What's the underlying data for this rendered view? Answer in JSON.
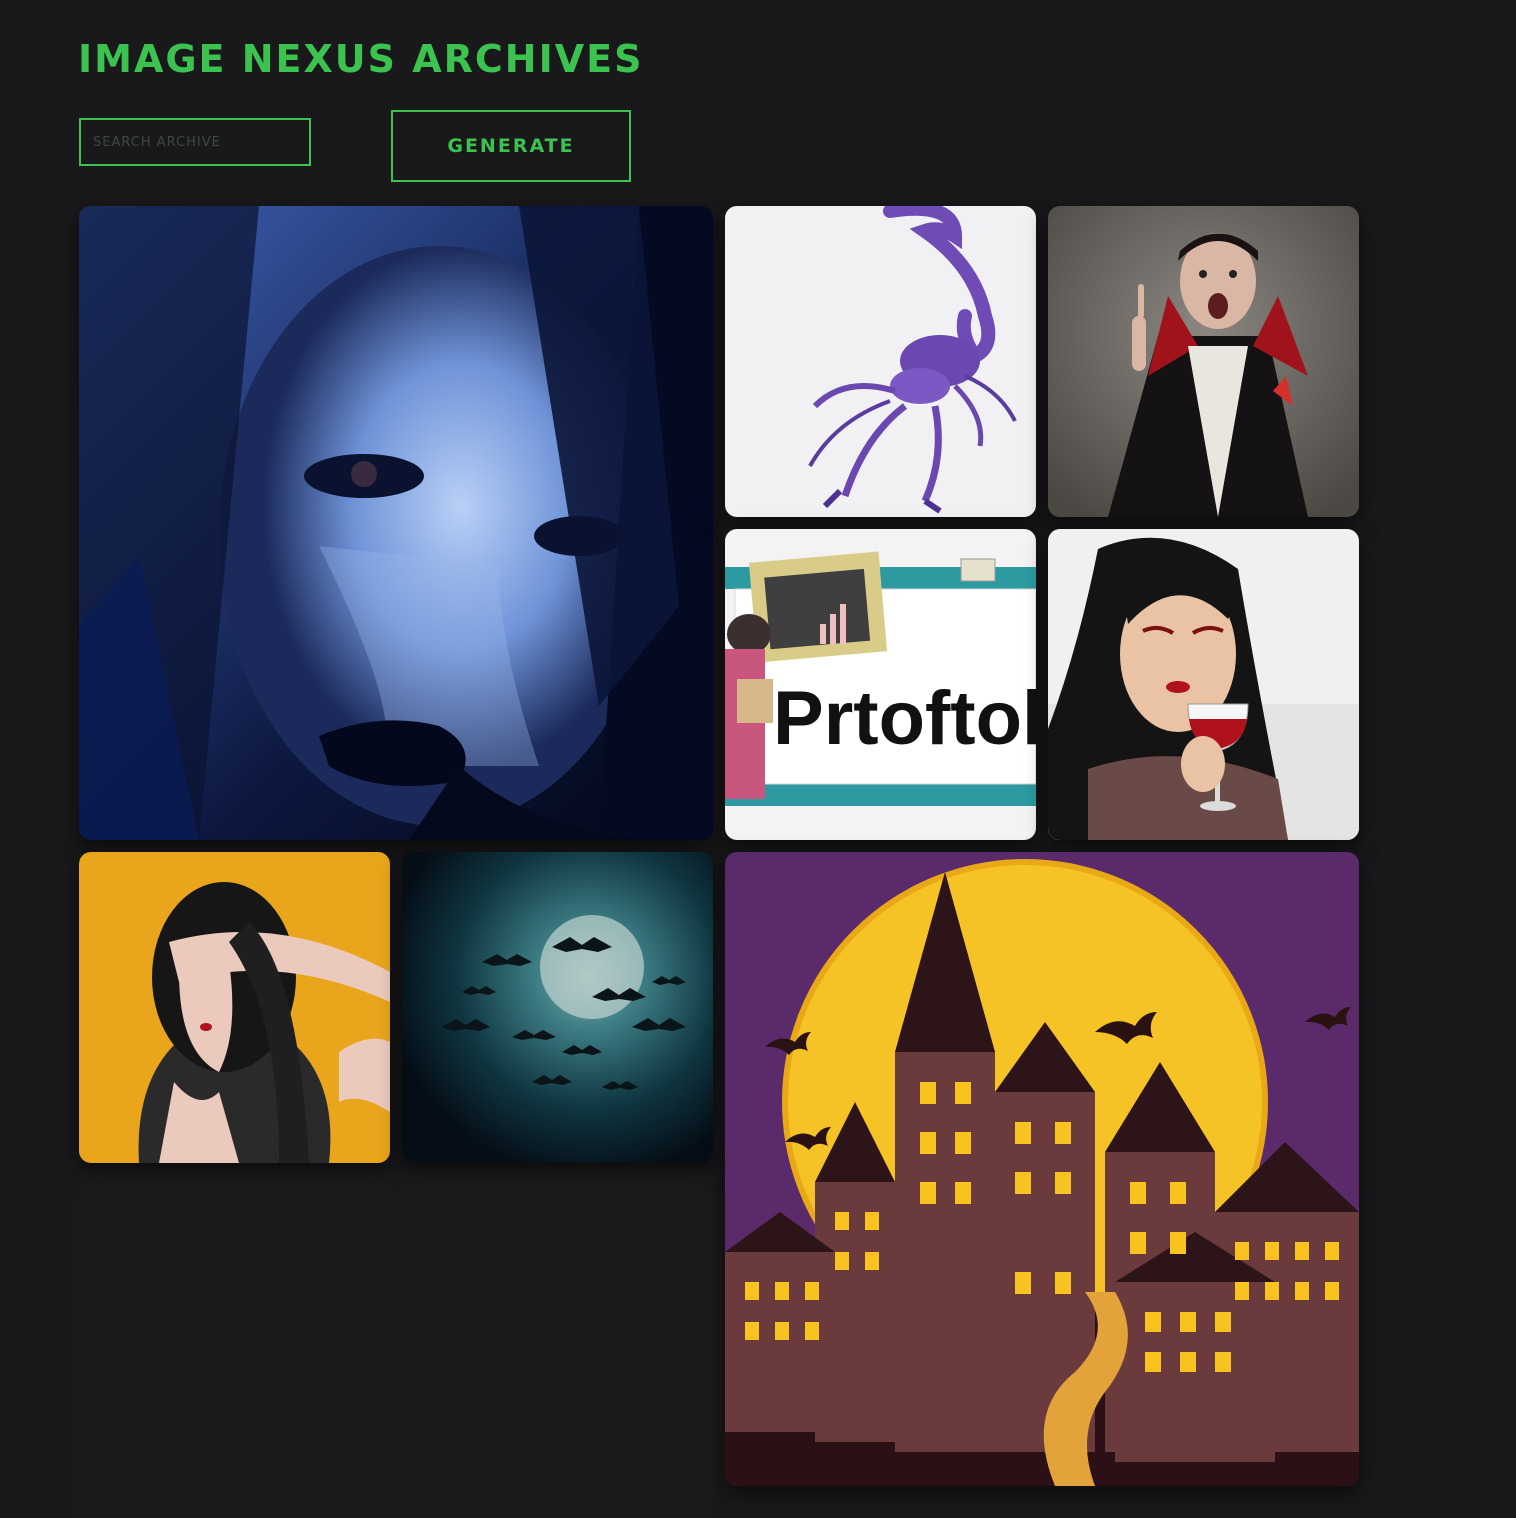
{
  "header": {
    "title": "IMAGE NEXUS ARCHIVES"
  },
  "search": {
    "placeholder": "SEARCH ARCHIVE",
    "value": ""
  },
  "generate_button": {
    "label": "GENERATE"
  },
  "colors": {
    "accent": "#3cc24f",
    "background": "#19191b"
  },
  "gallery": {
    "items": [
      {
        "id": "blue-gothic-portrait"
      },
      {
        "id": "purple-scorpion"
      },
      {
        "id": "vampire-man"
      },
      {
        "id": "portfolio-illustration",
        "text": "Prtoftol"
      },
      {
        "id": "vampire-woman-wine"
      },
      {
        "id": "woman-yellow-background"
      },
      {
        "id": "bats-full-moon"
      },
      {
        "id": "haunted-castle-moon"
      }
    ]
  }
}
